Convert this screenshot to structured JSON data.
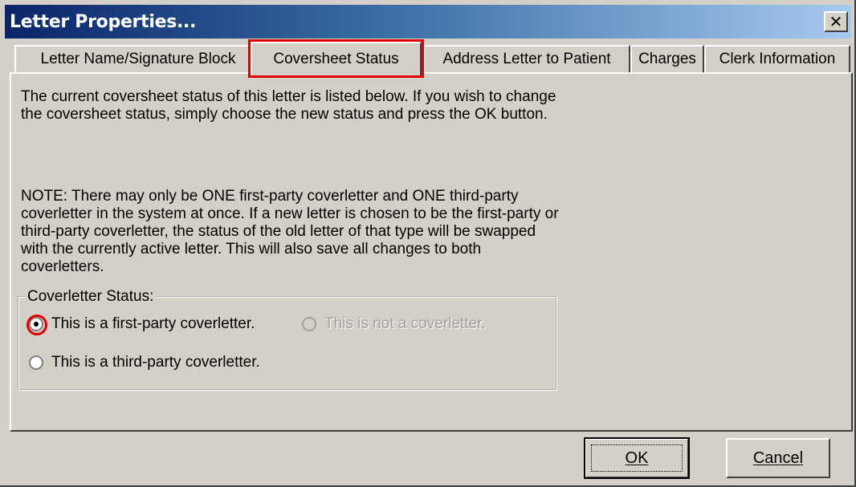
{
  "window": {
    "title": "Letter Properties...",
    "close_glyph": "✕"
  },
  "tabs": [
    {
      "label": "Letter Name/Signature  Block"
    },
    {
      "label": "Coversheet Status"
    },
    {
      "label": "Address Letter to Patient"
    },
    {
      "label": "Charges"
    },
    {
      "label": "Clerk Information"
    }
  ],
  "content": {
    "paragraph1": "The current coversheet status of this letter is listed below.  If you wish to change the coversheet status, simply choose the new status and press the OK button.",
    "paragraph2": "NOTE:  There may only be ONE first-party coverletter and ONE third-party coverletter in the system at once.  If a new letter is chosen to be the first-party or third-party coverletter, the status of the old letter of that type will be swapped with the currently active letter.  This will also save all changes to both coverletters.",
    "group_title": "Coverletter Status:",
    "options": [
      {
        "label": "This is a first-party coverletter.",
        "checked": true,
        "enabled": true
      },
      {
        "label": "This is not a coverletter.",
        "checked": false,
        "enabled": false
      },
      {
        "label": "This is a third-party coverletter.",
        "checked": false,
        "enabled": true
      }
    ]
  },
  "buttons": {
    "ok": "OK",
    "cancel": "Cancel"
  },
  "colors": {
    "title_bar_start": "#0a246a",
    "title_bar_end": "#a6caf0",
    "highlight": "#e00000",
    "face": "#d4d0c8"
  }
}
